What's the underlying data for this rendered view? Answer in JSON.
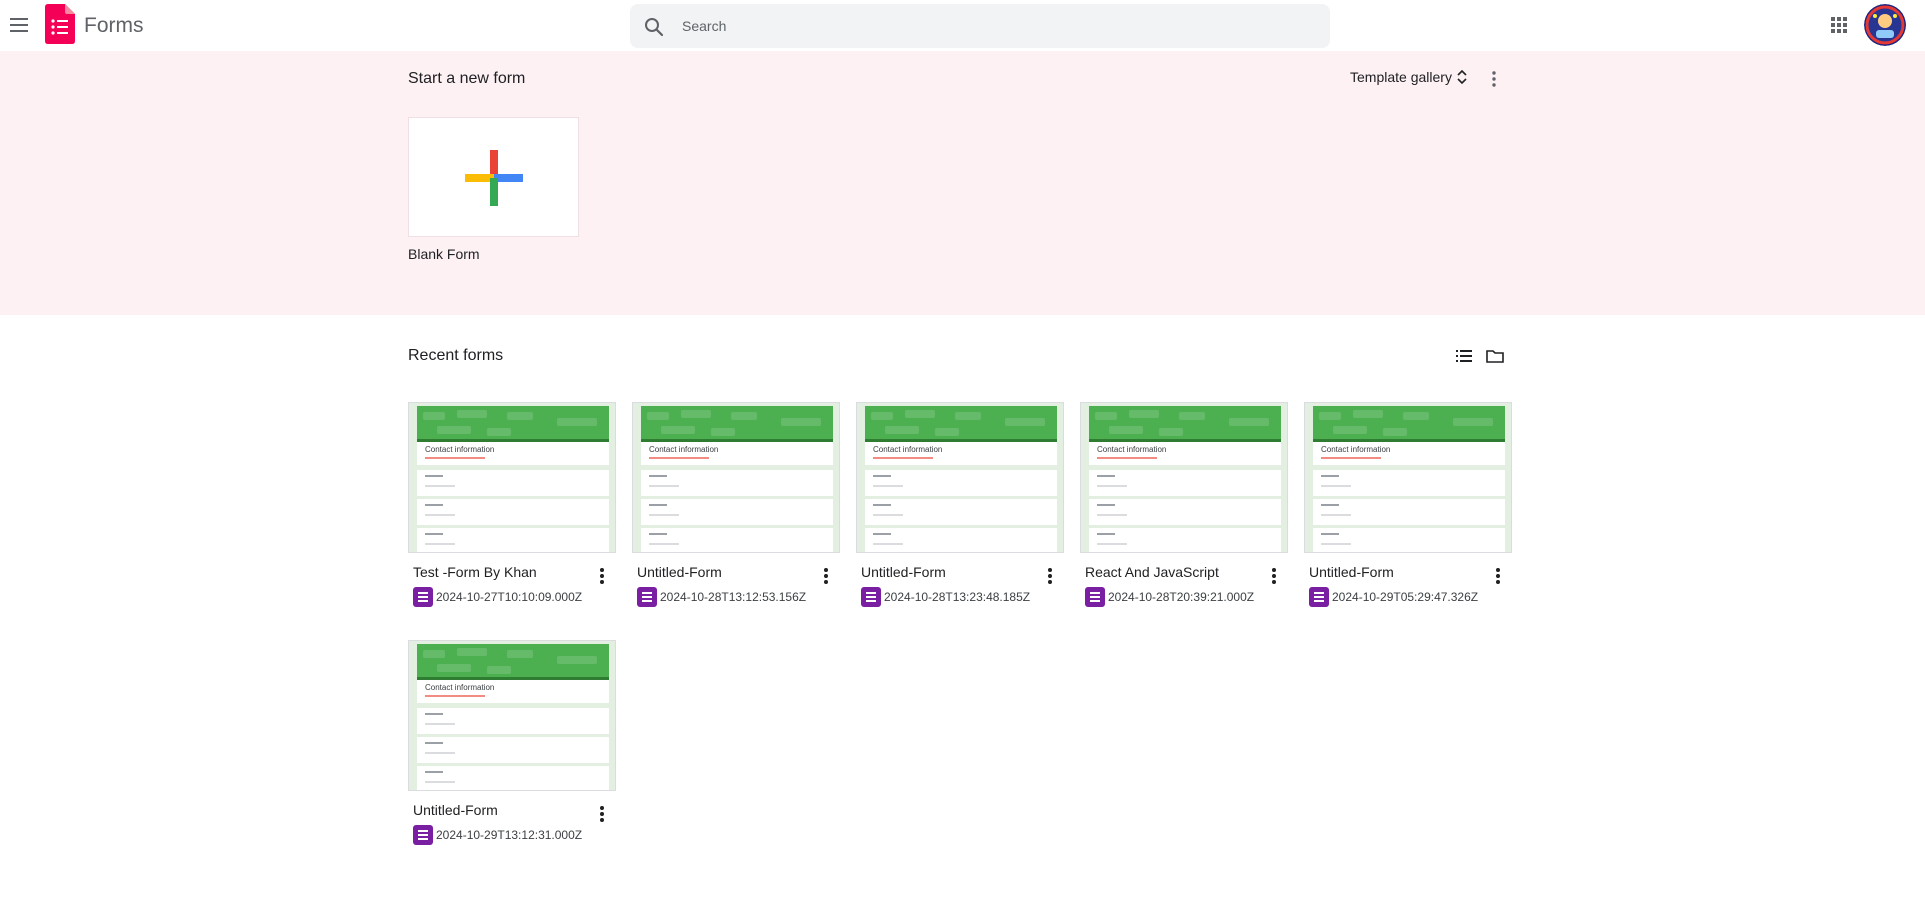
{
  "app": {
    "title": "Forms"
  },
  "search": {
    "placeholder": "Search"
  },
  "start": {
    "title": "Start a new form",
    "template_gallery_label": "Template gallery",
    "blank_label": "Blank Form"
  },
  "recent": {
    "title": "Recent forms",
    "thumbnail_heading": "Contact information",
    "forms": [
      {
        "title": "Test -Form By Khan",
        "date": "2024-10-27T10:10:09.000Z"
      },
      {
        "title": "Untitled-Form",
        "date": "2024-10-28T13:12:53.156Z"
      },
      {
        "title": "Untitled-Form",
        "date": "2024-10-28T13:23:48.185Z"
      },
      {
        "title": "React And JavaScript",
        "date": "2024-10-28T20:39:21.000Z"
      },
      {
        "title": "Untitled-Form",
        "date": "2024-10-29T05:29:47.326Z"
      },
      {
        "title": "Untitled-Form",
        "date": "2024-10-29T13:12:31.000Z"
      }
    ]
  },
  "colors": {
    "brand": "#f50057",
    "start_bg": "#fdf1f4",
    "form_icon": "#7b1fa2",
    "thumb_green": "#4caf50"
  },
  "icons": [
    "menu-icon",
    "forms-logo-icon",
    "search-icon",
    "apps-icon",
    "avatar",
    "unfold-icon",
    "more-vert-icon",
    "plus-icon",
    "list-view-icon",
    "folder-icon",
    "form-doc-icon"
  ]
}
